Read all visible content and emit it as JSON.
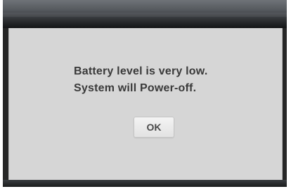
{
  "dialog": {
    "message_line1": "Battery level is very low.",
    "message_line2": "System will Power-off.",
    "ok_label": "OK"
  },
  "colors": {
    "title_bar": "#55595e",
    "frame": "#262626",
    "body": "#d6d6d6",
    "text": "#3a3a3a",
    "button": "#ececec"
  }
}
